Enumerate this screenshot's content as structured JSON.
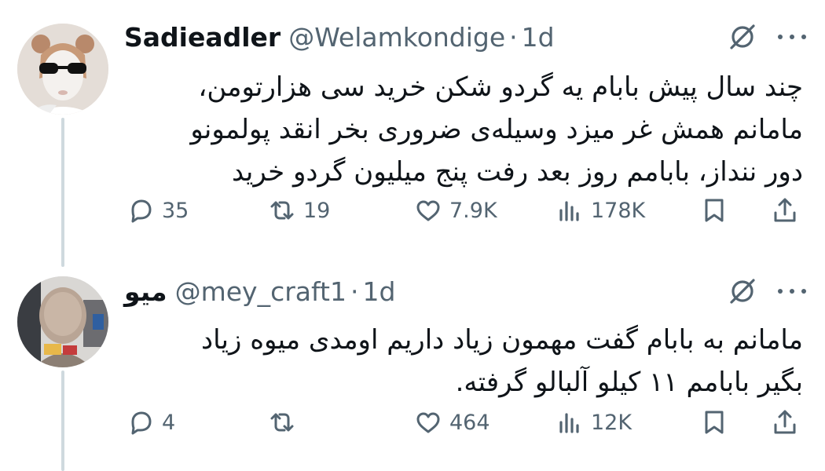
{
  "tweets": [
    {
      "display_name": "Sadieadler",
      "handle": "@Welamkondige",
      "separator": "·",
      "age": "1d",
      "text": "چند سال پیش بابام یه گردو شکن خرید سی هزارتومن،\nمامانم همش غر میزد وسیله‌ی ضروری بخر انقد پولمونو\nدور ننداز، بابامم روز بعد رفت پنج میلیون گردو خرید",
      "stats": {
        "replies": "35",
        "retweets": "19",
        "likes": "7.9K",
        "views": "178K"
      }
    },
    {
      "display_name": "میو",
      "handle": "@mey_craft1",
      "separator": "·",
      "age": "1d",
      "text": "مامانم به بابام گفت مهمون زیاد داریم اومدی میوه زیاد\nبگیر بابامم ۱۱ کیلو آلبالو گرفته.",
      "stats": {
        "replies": "4",
        "retweets": "",
        "likes": "464",
        "views": "12K"
      }
    }
  ],
  "icons": [
    "reply-icon",
    "retweet-icon",
    "like-icon",
    "views-icon",
    "bookmark-icon",
    "share-icon",
    "grok-icon",
    "more-icon"
  ],
  "colors": {
    "text": "#0f1419",
    "secondary": "#536471",
    "thread_line": "#cfd9de",
    "background": "#ffffff"
  }
}
